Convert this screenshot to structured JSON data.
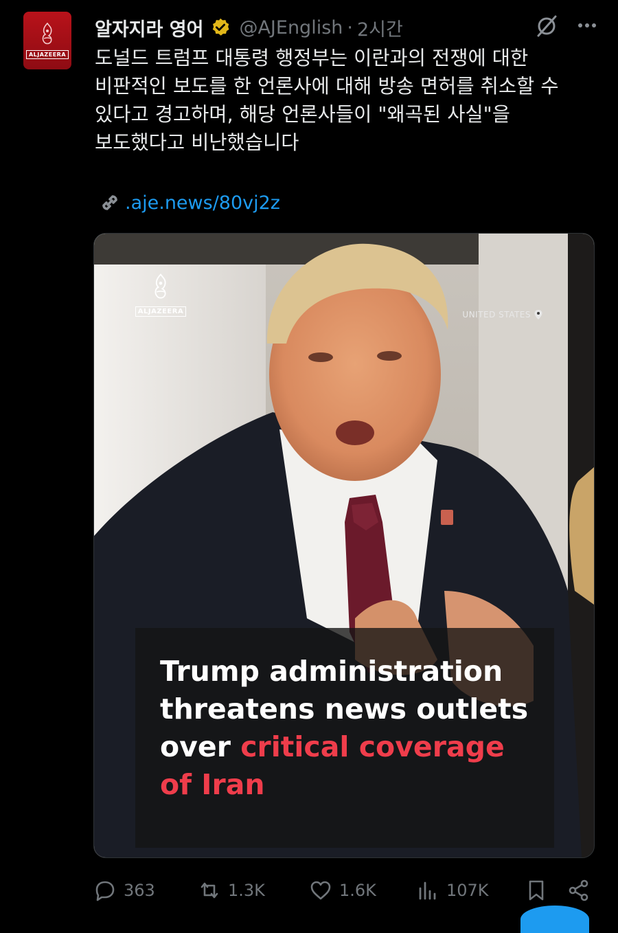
{
  "account": {
    "name": "알자지라 영어",
    "handle": "@AJEnglish",
    "separator": "·",
    "time": "2시간",
    "avatar_wordmark": "ALJAZEERA"
  },
  "tweet": {
    "text": "도널드 트럼프 대통령 행정부는 이란과의 전쟁에 대한 비판적인 보도를 한 언론사에 대해 방송 면허를 취소할 수 있다고 경고하며, 해당 언론사들이 \"왜곡된 사실\"을 보도했다고 비난했습니다",
    "link": ".aje.news/80vj2z"
  },
  "media": {
    "logo_wordmark": "ALJAZEERA",
    "location": "UNITED STATES",
    "headline_white": "Trump administration threatens news outlets over ",
    "headline_red": "critical coverage of Iran"
  },
  "actions": {
    "replies": "363",
    "reposts": "1.3K",
    "likes": "1.6K",
    "views": "107K"
  },
  "colors": {
    "background": "#000000",
    "text_primary": "#e7e9ea",
    "text_secondary": "#71767b",
    "link": "#1d9bf0",
    "verified_badge": "#e2b719",
    "headline_accent": "#ef3d4b",
    "brand_red": "#b8121a"
  },
  "icons": {
    "verified": "verified-badge-icon",
    "grok": "grok-icon",
    "more": "more-icon",
    "link": "link-icon",
    "reply": "reply-icon",
    "repost": "repost-icon",
    "like": "heart-icon",
    "views": "views-icon",
    "bookmark": "bookmark-icon",
    "share": "share-icon"
  }
}
